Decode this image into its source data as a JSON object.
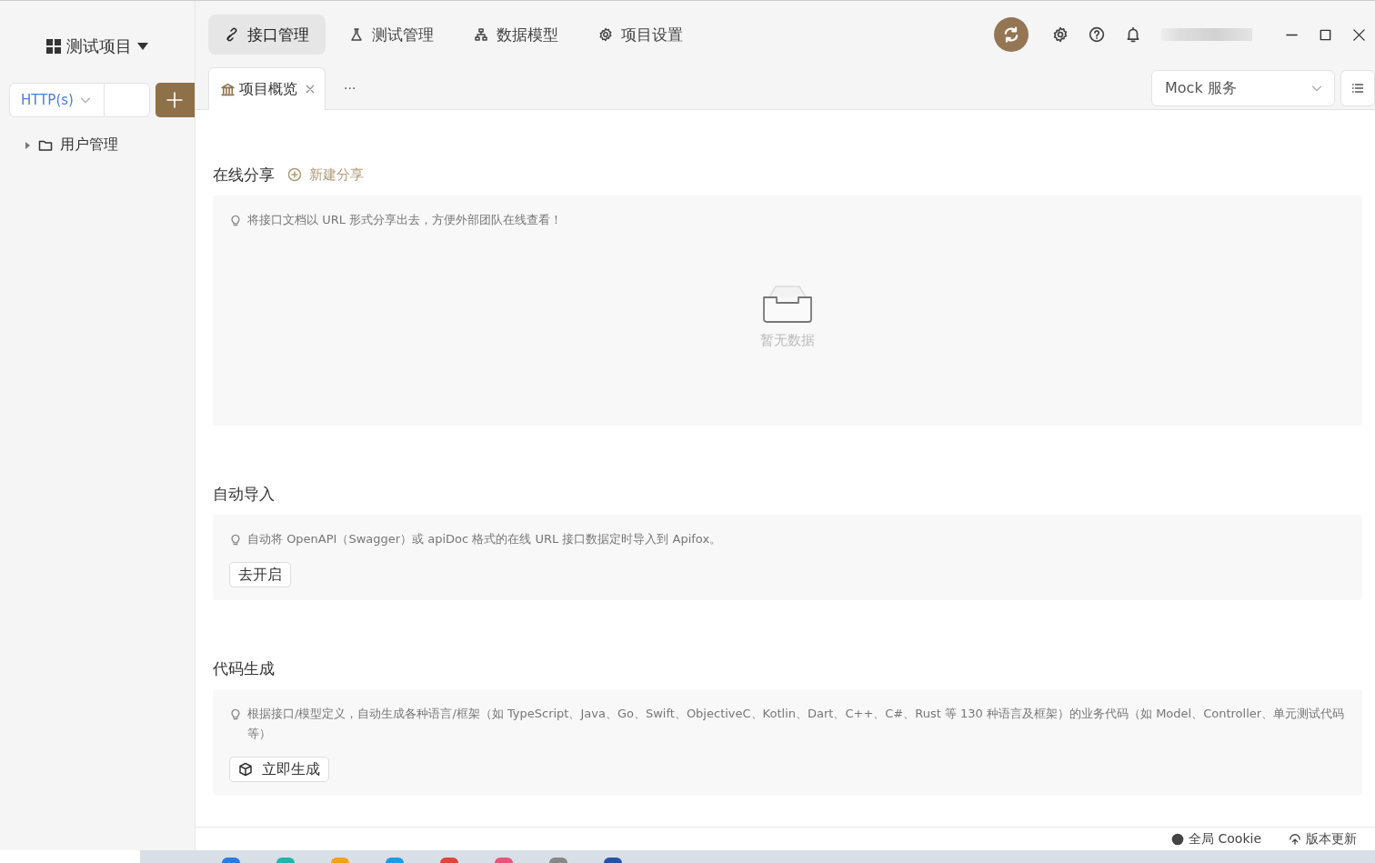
{
  "sidebar": {
    "project": "测试项目",
    "protocol_select": {
      "value": "HTTP(s)"
    },
    "tree": [
      {
        "label": "用户管理",
        "expanded": false
      }
    ]
  },
  "nav_tabs": [
    {
      "label": "接口管理",
      "selected": true
    },
    {
      "label": "测试管理",
      "selected": false
    },
    {
      "label": "数据模型",
      "selected": false
    },
    {
      "label": "项目设置",
      "selected": false
    }
  ],
  "doc_tabs": [
    {
      "label": "项目概览",
      "selected": true
    }
  ],
  "doc_tabs_more": "···",
  "environment_select": {
    "value": "Mock 服务"
  },
  "sections": [
    {
      "title": "在线分享",
      "action": "新建分享",
      "tip": "将接口文档以 URL 形式分享出去，方便外部团队在线查看！",
      "kind": "empty",
      "empty_text": "暂无数据"
    },
    {
      "title": "自动导入",
      "tip": "自动将 OpenAPI（Swagger）或 apiDoc 格式的在线 URL 接口数据定时导入到 Apifox。",
      "kind": "button",
      "button": "去开启"
    },
    {
      "title": "代码生成",
      "tip": "根据接口/模型定义，自动生成各种语言/框架（如 TypeScript、Java、Go、Swift、ObjectiveC、Kotlin、Dart、C++、C#、Rust 等 130 种语言及框架）的业务代码（如 Model、Controller、单元测试代码等）",
      "kind": "icon_button",
      "button": "立即生成"
    }
  ],
  "status_bar": {
    "items": [
      {
        "label": "全局 Cookie"
      },
      {
        "label": "版本更新"
      }
    ]
  }
}
